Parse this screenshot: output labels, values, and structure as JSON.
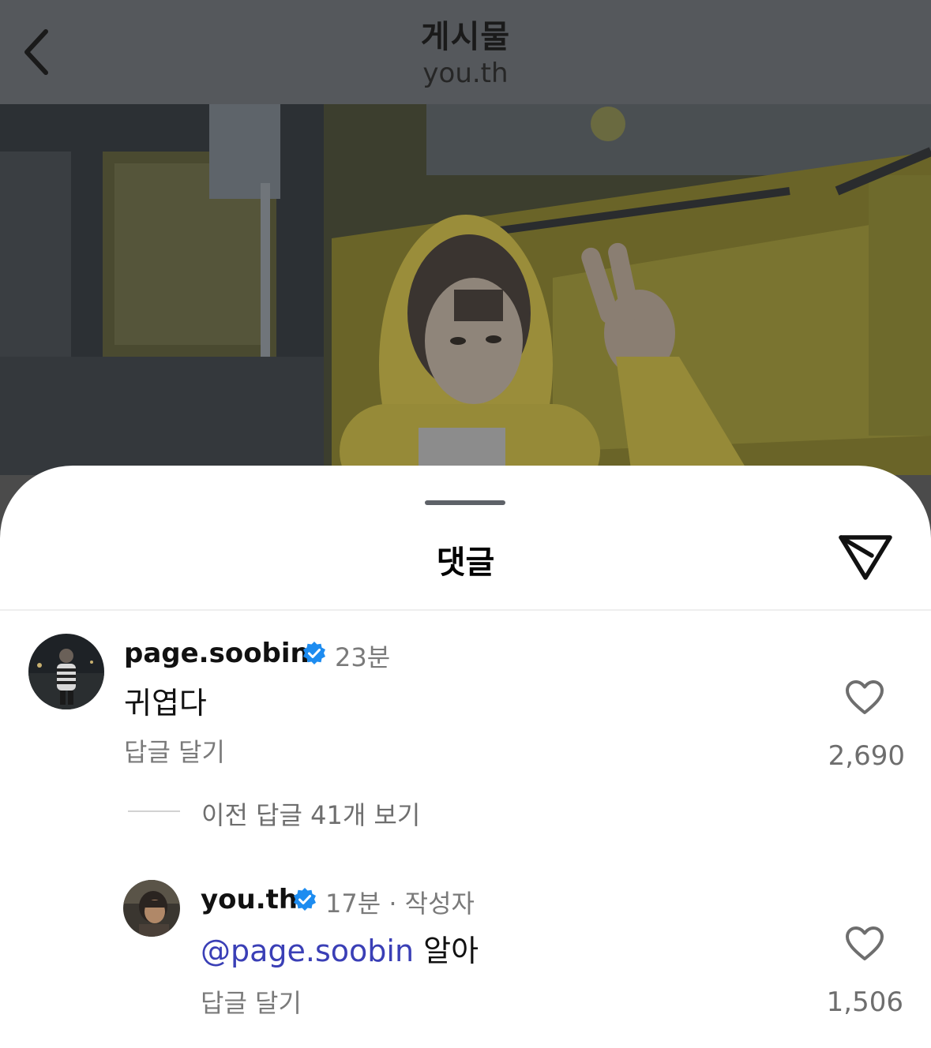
{
  "header": {
    "title": "게시물",
    "subtitle": "you.th",
    "back_icon": "chevron-left-icon"
  },
  "sheet": {
    "title": "댓글",
    "share_icon": "send-icon"
  },
  "comments": [
    {
      "username": "page.soobin",
      "verified": true,
      "time": "23분",
      "text": "귀엽다",
      "reply_label": "답글 달기",
      "likes": "2,690"
    }
  ],
  "view_replies": "이전 답글 41개 보기",
  "replies": [
    {
      "username": "you.th",
      "verified": true,
      "time": "17분 · 작성자",
      "mention": "@page.soobin",
      "text": " 알아",
      "reply_label": "답글 달기",
      "likes": "1,506"
    }
  ],
  "colors": {
    "verified_blue": "#1d8cf0",
    "mention_blue": "#3a3fb6",
    "hoodie_yellow": "#b7a640"
  }
}
